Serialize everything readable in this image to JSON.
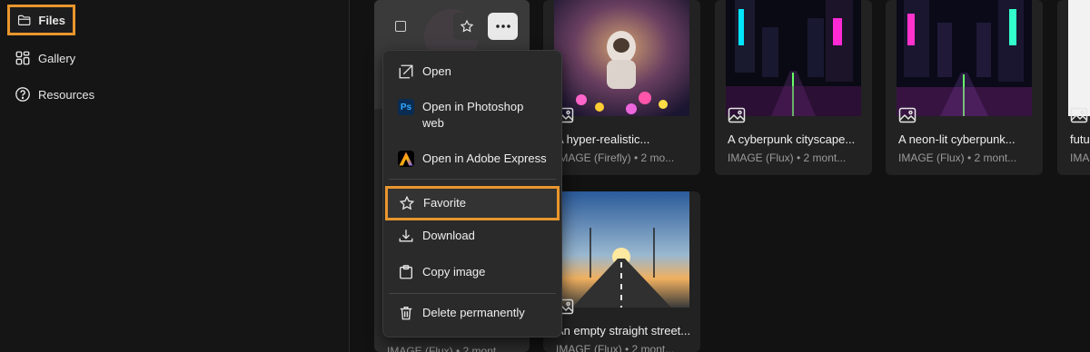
{
  "sidebar": {
    "items": [
      {
        "label": "Files",
        "icon": "folder-icon",
        "selected": true
      },
      {
        "label": "Gallery",
        "icon": "grid-icon"
      },
      {
        "label": "Resources",
        "icon": "help-circle-icon"
      }
    ]
  },
  "cards": [
    {
      "title": "A hyper-realistic...",
      "meta": "IMAGE (Firefly) • 2 mo..."
    },
    {
      "title": "A cyberpunk cityscape...",
      "meta": "IMAGE (Flux) • 2 mont..."
    },
    {
      "title": "A neon-lit cyberpunk...",
      "meta": "IMAGE (Flux) • 2 mont..."
    },
    {
      "title": "futu",
      "meta": "IMAG"
    },
    {
      "title": "An empty straight street...",
      "meta": "IMAGE (Flux) • 2 mont..."
    },
    {
      "title": "",
      "meta": "IMAGE (Flux) • 2 mont..."
    }
  ],
  "context_menu": {
    "items": [
      {
        "label": "Open",
        "icon": "open-external-icon"
      },
      {
        "label": "Open in Photoshop web",
        "icon": "photoshop-icon",
        "icon_text": "Ps"
      },
      {
        "label": "Open in Adobe Express",
        "icon": "adobe-express-icon"
      },
      {
        "label": "Favorite",
        "icon": "star-icon",
        "highlighted": true
      },
      {
        "label": "Download",
        "icon": "download-icon"
      },
      {
        "label": "Copy image",
        "icon": "clipboard-icon"
      },
      {
        "label": "Delete permanently",
        "icon": "trash-icon"
      }
    ]
  },
  "colors": {
    "highlight": "#e8962e",
    "background": "#121212",
    "card": "#222222"
  }
}
